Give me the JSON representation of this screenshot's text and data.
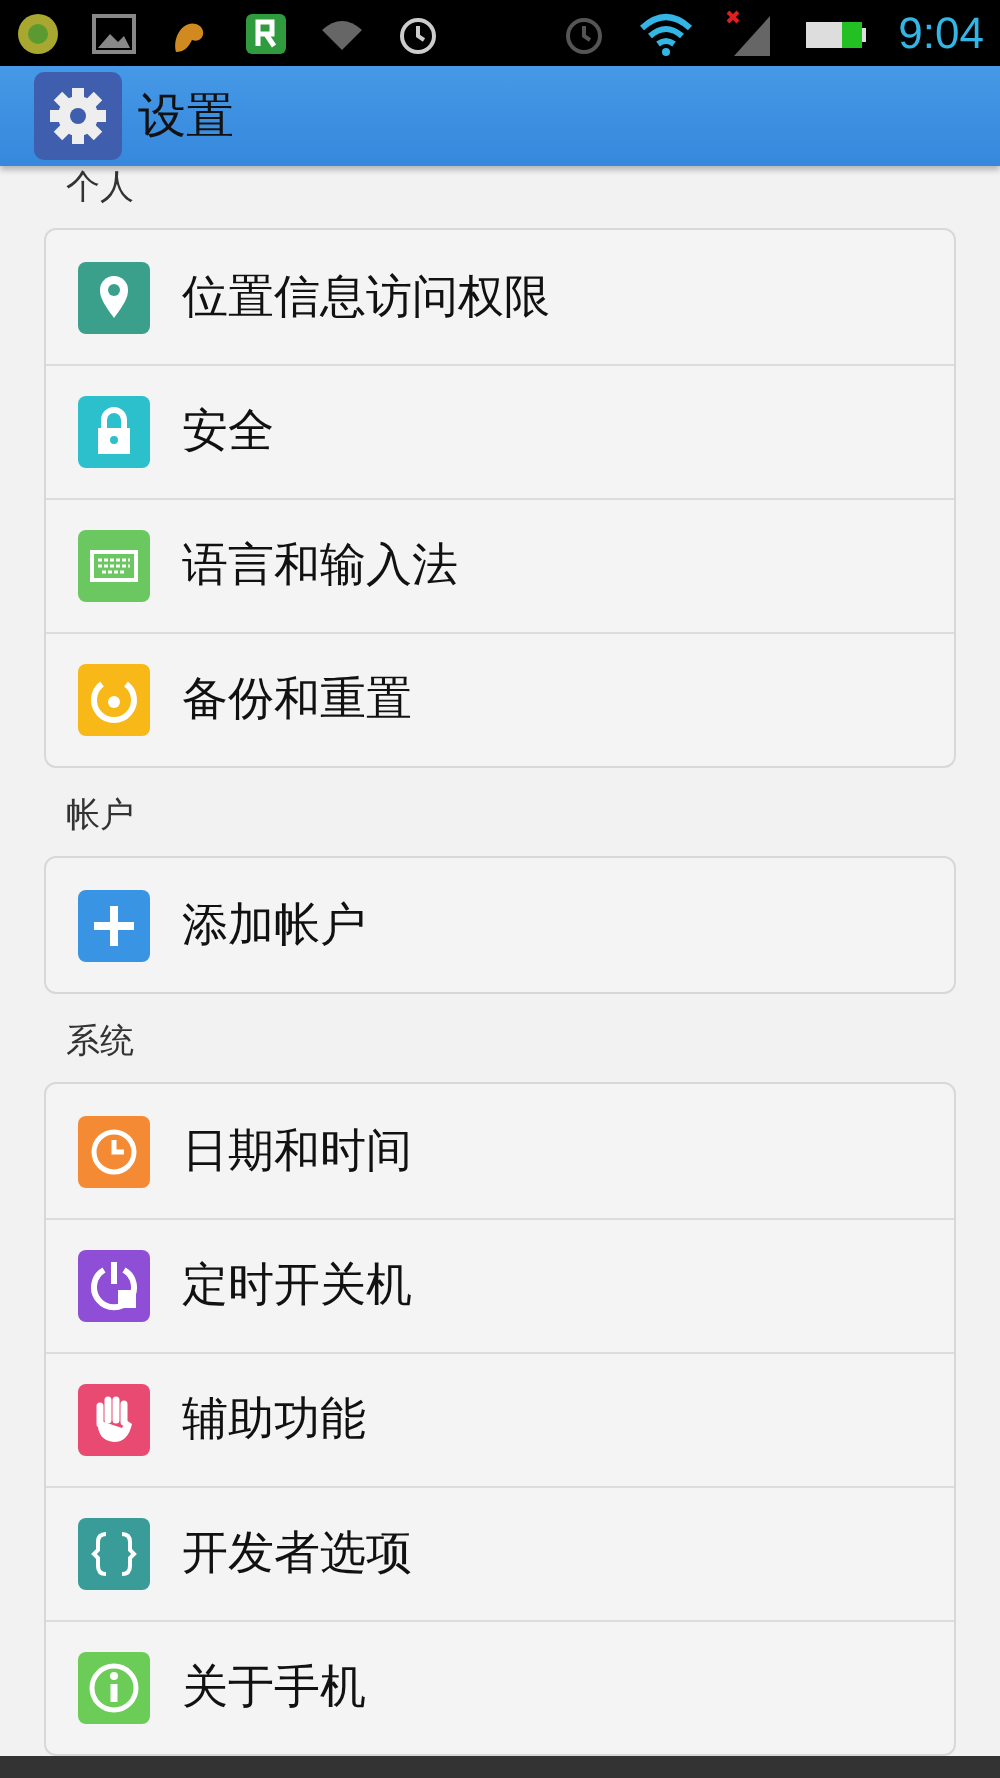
{
  "status_bar": {
    "time": "9:04"
  },
  "header": {
    "title": "设置"
  },
  "sections": [
    {
      "title": "个人",
      "items": [
        {
          "label": "位置信息访问权限",
          "kind": "location"
        },
        {
          "label": "安全",
          "kind": "lock"
        },
        {
          "label": "语言和输入法",
          "kind": "keyboard"
        },
        {
          "label": "备份和重置",
          "kind": "backup"
        }
      ]
    },
    {
      "title": "帐户",
      "items": [
        {
          "label": "添加帐户",
          "kind": "add"
        }
      ]
    },
    {
      "title": "系统",
      "items": [
        {
          "label": "日期和时间",
          "kind": "clock"
        },
        {
          "label": "定时开关机",
          "kind": "power"
        },
        {
          "label": "辅助功能",
          "kind": "hand"
        },
        {
          "label": "开发者选项",
          "kind": "braces"
        },
        {
          "label": "关于手机",
          "kind": "info"
        }
      ]
    }
  ]
}
